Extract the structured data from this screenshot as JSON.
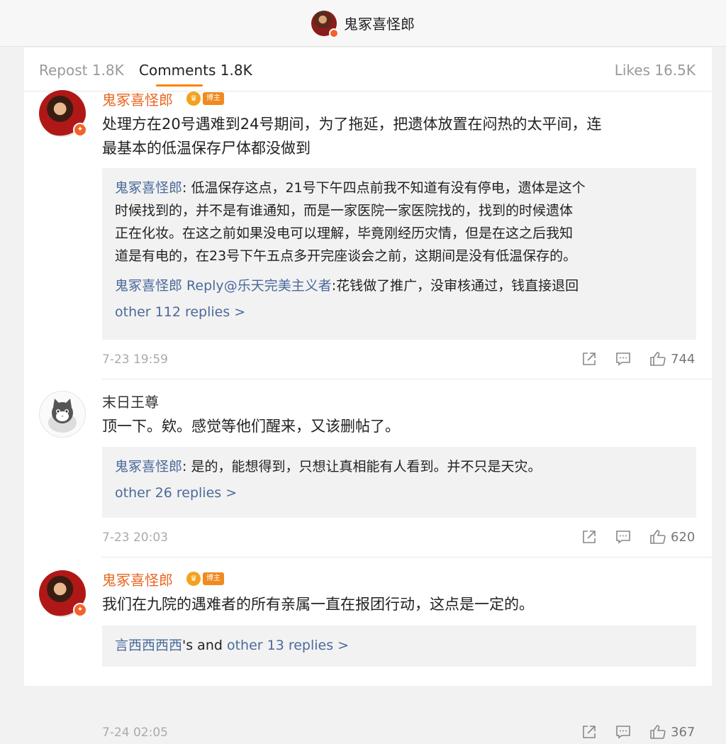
{
  "header": {
    "title": "鬼冢喜怪郎"
  },
  "tabs": [
    {
      "label": "Repost 1.8K"
    },
    {
      "label": "Comments 1.8K"
    },
    {
      "label": "Likes 16.5K"
    }
  ],
  "comments": [
    {
      "user": "鬼冢喜怪郎",
      "badge": "博主",
      "text_lines": [
        "处理方在20号遇难到24号期间，为了拖延，把遗体放置在闷热的太平间，连",
        "最基本的低温保存尸体都没做到"
      ],
      "replies": [
        {
          "name": "鬼冢喜怪郎",
          "lines": [
            ": 低温保存这点，21号下午四点前我不知道有没有停电，遗体是这个",
            "时候找到的，并不是有谁通知，而是一家医院一家医院找的，找到的时候遗体",
            "正在化妆。在这之前如果没电可以理解，毕竟刚经历灾情，但是在这之后我知",
            "道是有电的，在23号下午五点多开完座谈会之前，这期间是没有低温保存的。"
          ]
        },
        {
          "name": "鬼冢喜怪郎",
          "mid": " Reply",
          "mention": "@乐天完美主义者",
          "lines": [
            ":花钱做了推广，没审核通过，钱直接退回"
          ]
        }
      ],
      "more": "other 112 replies >",
      "time": "7-23 19:59",
      "likes": "744"
    },
    {
      "user": "末日王尊",
      "text_lines": [
        "顶一下。欸。感觉等他们醒来，又该删帖了。"
      ],
      "replies": [
        {
          "name": "鬼冢喜怪郎",
          "lines": [
            ": 是的，能想得到，只想让真相能有人看到。并不只是天灾。"
          ]
        }
      ],
      "more": "other 26 replies >",
      "time": "7-23 20:03",
      "likes": "620"
    },
    {
      "user": "鬼冢喜怪郎",
      "badge": "博主",
      "text_lines": [
        "我们在九院的遇难者的所有亲属一直在报团行动，这点是一定的。"
      ],
      "reply_summary": {
        "name": "言西西西西",
        "mid": "'s and ",
        "more": "other 13 replies >"
      },
      "time": "7-24 02:05",
      "likes": "367"
    }
  ]
}
